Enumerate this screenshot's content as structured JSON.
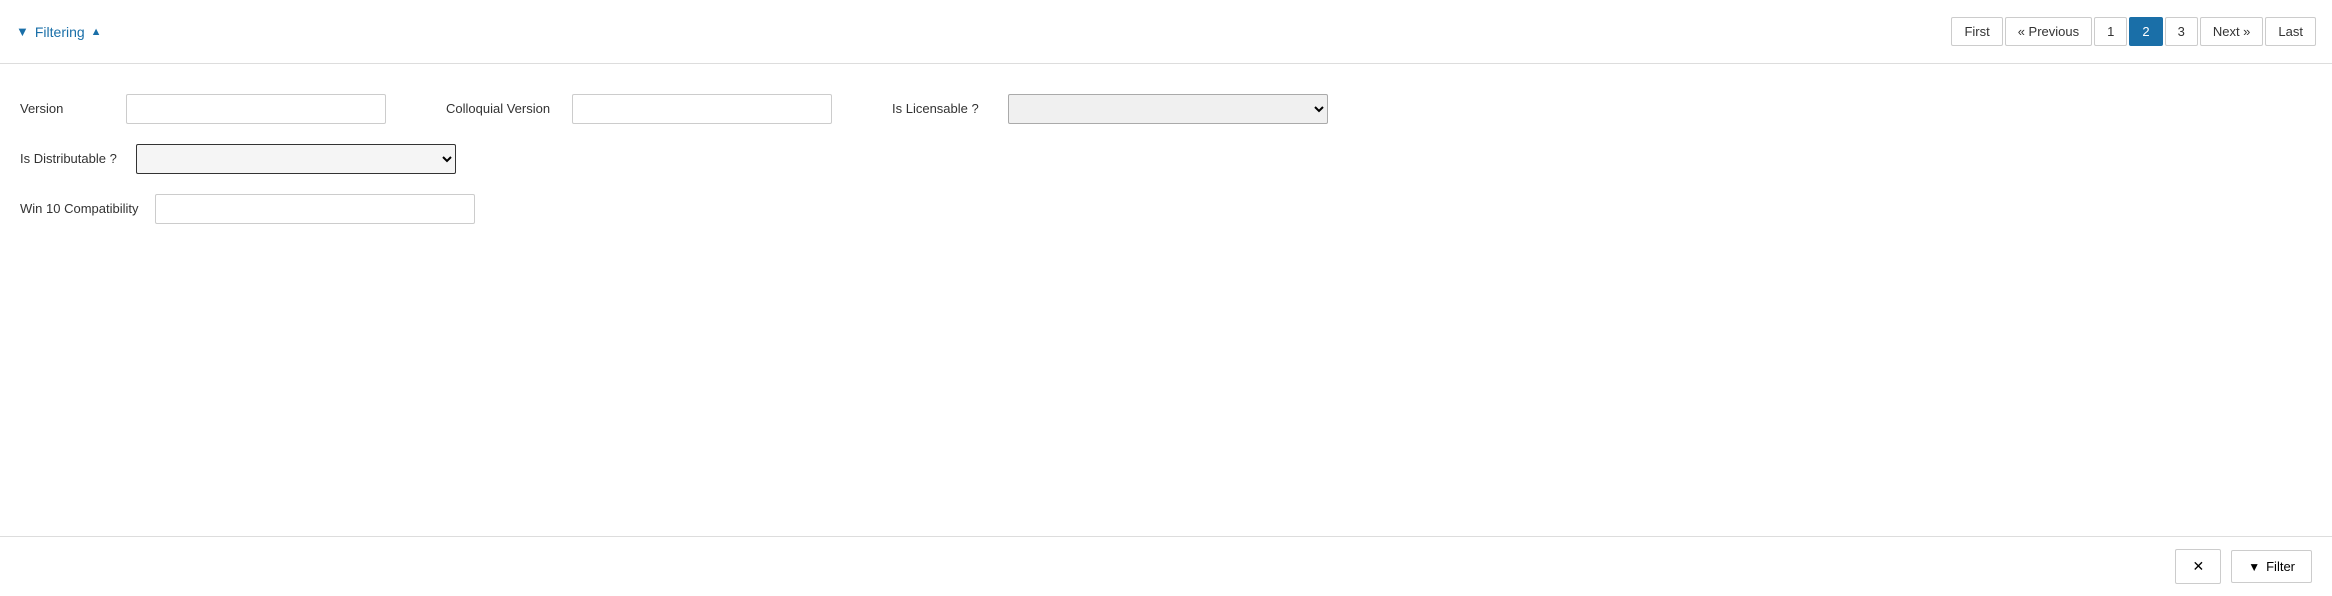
{
  "header": {
    "filtering_label": "Filtering",
    "filtering_icon": "▼",
    "sort_icon": "▲"
  },
  "pagination": {
    "first_label": "First",
    "previous_label": "« Previous",
    "page1_label": "1",
    "page2_label": "2",
    "page3_label": "3",
    "next_label": "Next »",
    "last_label": "Last"
  },
  "form": {
    "version_label": "Version",
    "version_value": "",
    "version_placeholder": "",
    "colloquial_version_label": "Colloquial Version",
    "colloquial_version_value": "",
    "is_licensable_label": "Is Licensable ?",
    "is_distributable_label": "Is Distributable ?",
    "win10_label": "Win 10 Compatibility",
    "win10_value": ""
  },
  "bottom_bar": {
    "x_label": "✕",
    "filter_label": "Filter",
    "filter_icon": "▼"
  }
}
